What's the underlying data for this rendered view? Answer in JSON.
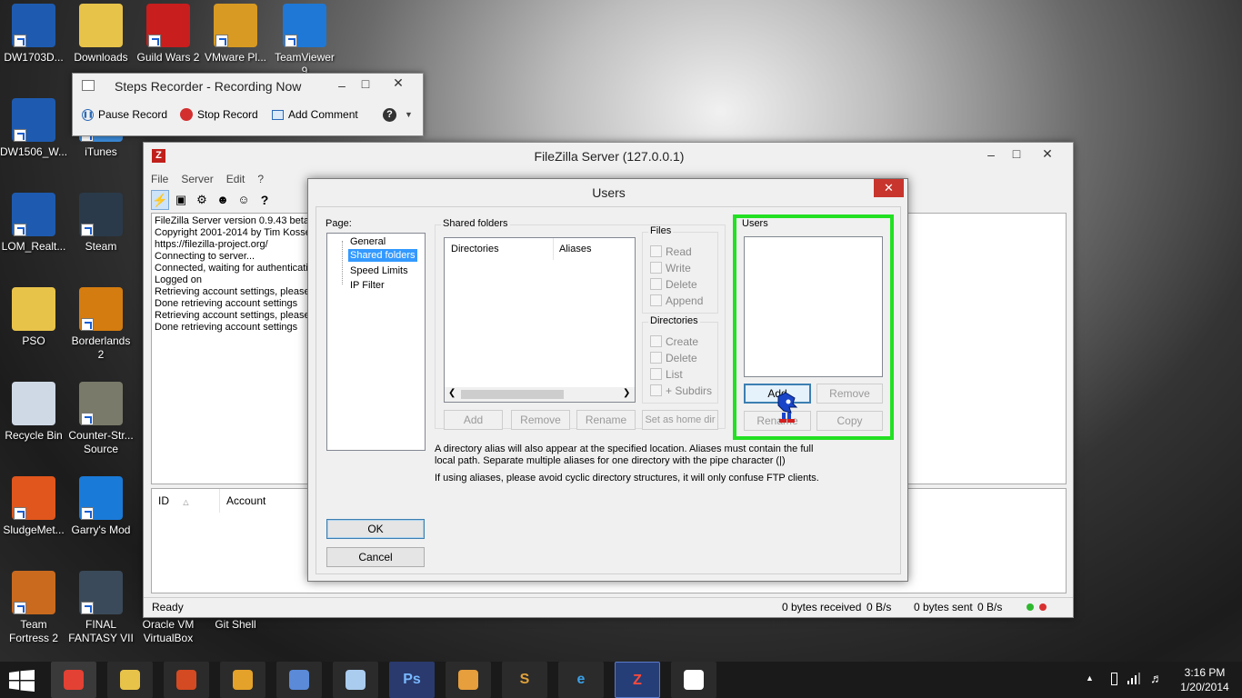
{
  "desktop_icons": [
    {
      "label": "DW1703D...",
      "name": "dw1703d-icon",
      "color": "#1e5bb0"
    },
    {
      "label": "Downloads",
      "name": "downloads-folder-icon",
      "color": "#e8c34a"
    },
    {
      "label": "Guild Wars 2",
      "name": "guild-wars-2-icon",
      "color": "#c81e1e"
    },
    {
      "label": "VMware Pl...",
      "name": "vmware-player-icon",
      "color": "#d89a22"
    },
    {
      "label": "TeamViewer 9",
      "name": "teamviewer-icon",
      "color": "#1f78d6"
    },
    {
      "label": "DW1506_W...",
      "name": "dw1506-icon",
      "color": "#1e5bb0"
    },
    {
      "label": "iTunes",
      "name": "itunes-icon",
      "color": "#3a8ad8"
    },
    {
      "label": "LOM_Realt...",
      "name": "lom-realtek-icon",
      "color": "#1e5bb0"
    },
    {
      "label": "Steam",
      "name": "steam-icon",
      "color": "#2a3a4a"
    },
    {
      "label": "PSO",
      "name": "pso-folder-icon",
      "color": "#e8c34a"
    },
    {
      "label": "Borderlands 2",
      "name": "borderlands-2-icon",
      "color": "#d47c10"
    },
    {
      "label": "Recycle Bin",
      "name": "recycle-bin-icon",
      "color": "#cfd9e6"
    },
    {
      "label": "Counter-Str... Source",
      "name": "counter-strike-icon",
      "color": "#7a7a6a"
    },
    {
      "label": "SludgeMet...",
      "name": "sludgemetal-icon",
      "color": "#e0561c"
    },
    {
      "label": "Garry's Mod",
      "name": "garrys-mod-icon",
      "color": "#1a7ad8"
    },
    {
      "label": "Team Fortress 2",
      "name": "team-fortress-2-icon",
      "color": "#c96a1e"
    },
    {
      "label": "FINAL FANTASY VII",
      "name": "final-fantasy-vii-icon",
      "color": "#3a4a5a"
    },
    {
      "label": "Oracle VM VirtualBox",
      "name": "virtualbox-icon",
      "color": "#2a5aa0"
    },
    {
      "label": "Git Shell",
      "name": "git-shell-icon",
      "color": "#333333"
    }
  ],
  "steps_recorder": {
    "title": "Steps Recorder - Recording Now",
    "pause": "Pause Record",
    "stop": "Stop Record",
    "comment": "Add Comment"
  },
  "filezilla": {
    "title": "FileZilla Server (127.0.0.1)",
    "menu": [
      "File",
      "Server",
      "Edit",
      "?"
    ],
    "log": [
      "FileZilla Server version 0.9.43 beta",
      "Copyright 2001-2014 by Tim Kosse (",
      "https://filezilla-project.org/",
      "Connecting to server...",
      "Connected, waiting for authenticatio",
      "Logged on",
      "Retrieving account settings, please w",
      "Done retrieving account settings",
      "Retrieving account settings, please w",
      "Done retrieving account settings"
    ],
    "columns": {
      "id": "ID",
      "account": "Account"
    },
    "status": {
      "ready": "Ready",
      "received": "0 bytes received",
      "recv_rate": "0 B/s",
      "sent": "0 bytes sent",
      "sent_rate": "0 B/s"
    }
  },
  "users_dialog": {
    "title": "Users",
    "page_label": "Page:",
    "pages": [
      "General",
      "Shared folders",
      "Speed Limits",
      "IP Filter"
    ],
    "selected_page": "Shared folders",
    "shared_folders_label": "Shared folders",
    "col_directories": "Directories",
    "col_aliases": "Aliases",
    "files_label": "Files",
    "files": [
      "Read",
      "Write",
      "Delete",
      "Append"
    ],
    "directories_label": "Directories",
    "directories": [
      "Create",
      "Delete",
      "List",
      "+ Subdirs"
    ],
    "folder_buttons": {
      "add": "Add",
      "remove": "Remove",
      "rename": "Rename",
      "home": "Set as home dir"
    },
    "users_label": "Users",
    "user_buttons": {
      "add": "Add",
      "remove": "Remove",
      "rename": "Rename",
      "copy": "Copy"
    },
    "note1": "A directory alias will also appear at the specified location. Aliases must contain the full local path. Separate multiple aliases for one directory with the pipe character (|)",
    "note2": "If using aliases, please avoid cyclic directory structures, it will only confuse FTP clients.",
    "ok": "OK",
    "cancel": "Cancel",
    "highlight_color": "#22e022"
  },
  "taskbar": {
    "apps": [
      {
        "name": "chrome-taskbar-icon",
        "label": ""
      },
      {
        "name": "file-explorer-taskbar-icon",
        "label": ""
      },
      {
        "name": "apps-taskbar-icon",
        "label": ""
      },
      {
        "name": "vmware-taskbar-icon",
        "label": ""
      },
      {
        "name": "virtualbox-taskbar-icon",
        "label": ""
      },
      {
        "name": "steam-taskbar-icon",
        "label": ""
      },
      {
        "name": "photoshop-taskbar-icon",
        "label": "Ps"
      },
      {
        "name": "media-player-taskbar-icon",
        "label": ""
      },
      {
        "name": "sublime-taskbar-icon",
        "label": "S"
      },
      {
        "name": "internet-explorer-taskbar-icon",
        "label": "e"
      },
      {
        "name": "filezilla-taskbar-icon",
        "label": "Z"
      },
      {
        "name": "steps-recorder-taskbar-icon",
        "label": ""
      }
    ],
    "time": "3:16 PM",
    "date": "1/20/2014"
  }
}
